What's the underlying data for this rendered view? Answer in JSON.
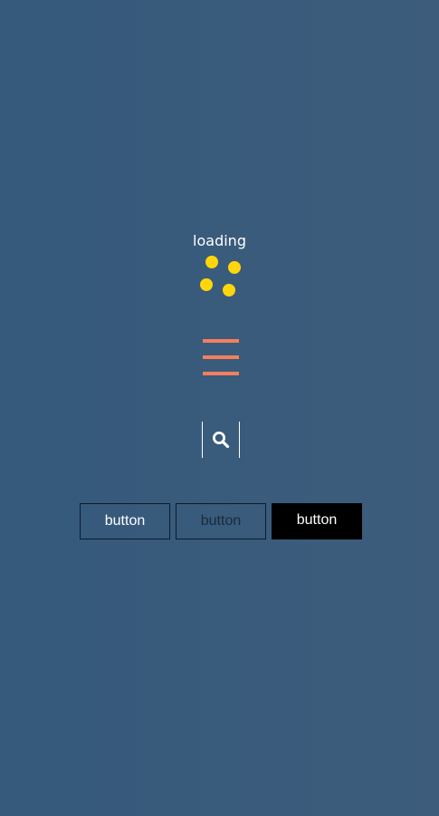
{
  "loader": {
    "label": "loading",
    "dot_color": "#ffd60a"
  },
  "menu": {
    "icon": "hamburger-icon",
    "color": "#f57f5b"
  },
  "search": {
    "icon": "search-icon",
    "color": "#ffffff"
  },
  "buttons": [
    {
      "label": "button"
    },
    {
      "label": "button"
    },
    {
      "label": "button"
    }
  ]
}
